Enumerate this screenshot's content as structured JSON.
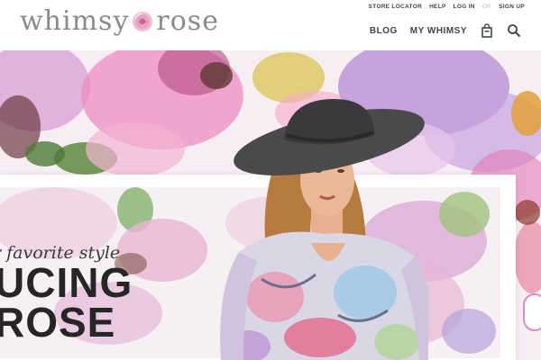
{
  "brand": {
    "logo_left": "whimsy",
    "logo_right": "rose"
  },
  "top_links": {
    "store_locator": "STORE LOCATOR",
    "help": "HELP",
    "log_in": "LOG IN",
    "or": "OR",
    "sign_up": "SIGN UP"
  },
  "nav": {
    "blog": "BLOG",
    "my_whimsy": "MY WHIMSY",
    "bag_icon": "shopping-bag-icon",
    "search_icon": "search-icon"
  },
  "hero": {
    "tagline": "r favorite style",
    "headline_line1": "UCING",
    "headline_line2": "ROSE"
  },
  "colors": {
    "logo_gray": "#8a8a8a",
    "rose_pink": "#e8a2c6",
    "text_dark": "#262626",
    "accent_pink": "#d98cc0"
  }
}
